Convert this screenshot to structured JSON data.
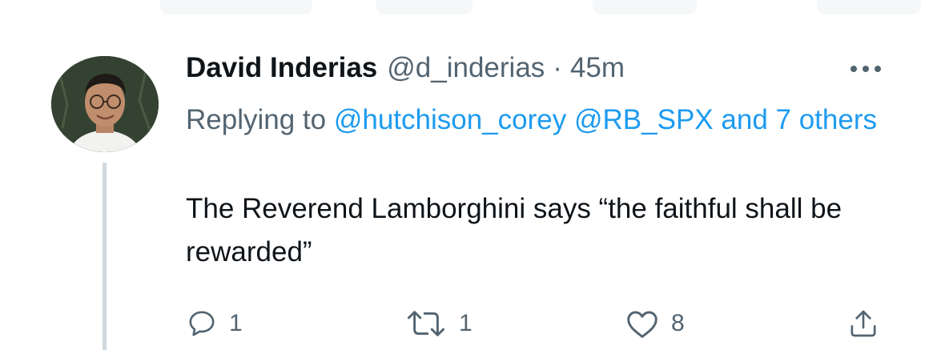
{
  "tweet": {
    "author": {
      "display_name": "David Inderias",
      "handle": "@d_inderias",
      "separator": "·",
      "time": "45m",
      "avatar_icon": "avatar-photo"
    },
    "replying": {
      "prefix": "Replying to",
      "user1": "@hutchison_corey",
      "user2": "@RB_SPX",
      "and_others": "and 7 others"
    },
    "text": "The Reverend Lamborghini says “the faithful shall be rewarded”",
    "actions": {
      "reply_count": "1",
      "retweet_count": "1",
      "like_count": "8"
    }
  },
  "colors": {
    "text": "#0f1419",
    "secondary": "#536471",
    "link": "#1d9bf0",
    "thread_line": "#cfd9de"
  }
}
